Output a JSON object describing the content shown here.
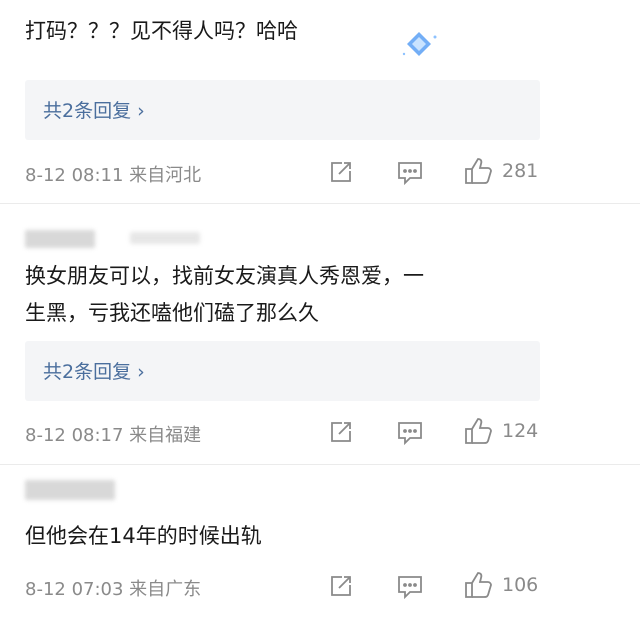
{
  "comments": [
    {
      "text": "打码？？？见不得人吗？哈哈",
      "replies": "共2条回复 ›",
      "meta": "8-12 08:11  来自河北",
      "likes": "281"
    },
    {
      "text_line1": "换女朋友可以，找前女友演真人秀恩爱，一",
      "text_line2": "生黑，亏我还嗑他们磕了那么久",
      "replies": "共2条回复 ›",
      "meta": "8-12 08:17  来自福建",
      "likes": "124"
    },
    {
      "text": "但他会在14年的时候出轨",
      "meta": "8-12 07:03  来自广东",
      "likes": "106"
    }
  ],
  "colors": {
    "link": "#4a6e9d",
    "meta": "#8a8a8a",
    "text": "#1a1a1a",
    "reply_bg": "#f4f5f7"
  },
  "icons": [
    "share-icon",
    "comment-icon",
    "like-icon",
    "badge-icon"
  ]
}
